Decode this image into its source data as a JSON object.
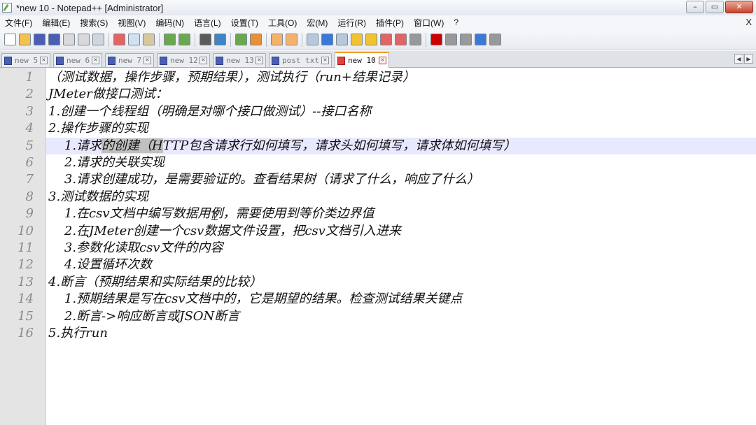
{
  "window": {
    "title": "*new 10 - Notepad++ [Administrator]",
    "minimize": "–",
    "maximize": "▭",
    "close": "✕"
  },
  "menu": [
    {
      "label": "文件(F)"
    },
    {
      "label": "编辑(E)"
    },
    {
      "label": "搜索(S)"
    },
    {
      "label": "视图(V)"
    },
    {
      "label": "编码(N)"
    },
    {
      "label": "语言(L)"
    },
    {
      "label": "设置(T)"
    },
    {
      "label": "工具(O)"
    },
    {
      "label": "宏(M)"
    },
    {
      "label": "运行(R)"
    },
    {
      "label": "插件(P)"
    },
    {
      "label": "窗口(W)"
    },
    {
      "label": "?"
    }
  ],
  "menu_close": "X",
  "toolbar_icons": [
    {
      "name": "new-file-icon",
      "color": "#ffffff"
    },
    {
      "name": "open-file-icon",
      "color": "#f2c14e"
    },
    {
      "name": "save-icon",
      "color": "#4a5fb4"
    },
    {
      "name": "save-all-icon",
      "color": "#4a5fb4"
    },
    {
      "name": "close-icon",
      "color": "#d9d9d9"
    },
    {
      "name": "close-all-icon",
      "color": "#d9d9d9"
    },
    {
      "name": "print-icon",
      "color": "#cfd6de"
    },
    {
      "sep": true
    },
    {
      "name": "cut-icon",
      "color": "#e06666"
    },
    {
      "name": "copy-icon",
      "color": "#cfe2f3"
    },
    {
      "name": "paste-icon",
      "color": "#d9c89e"
    },
    {
      "sep": true
    },
    {
      "name": "undo-icon",
      "color": "#6aa84f"
    },
    {
      "name": "redo-icon",
      "color": "#6aa84f"
    },
    {
      "sep": true
    },
    {
      "name": "find-icon",
      "color": "#5b5b5b"
    },
    {
      "name": "replace-icon",
      "color": "#3d85c6"
    },
    {
      "sep": true
    },
    {
      "name": "zoom-in-icon",
      "color": "#6aa84f"
    },
    {
      "name": "zoom-out-icon",
      "color": "#e69138"
    },
    {
      "sep": true
    },
    {
      "name": "sync-vertical-icon",
      "color": "#f6b26b"
    },
    {
      "name": "sync-horizontal-icon",
      "color": "#f6b26b"
    },
    {
      "sep": true
    },
    {
      "name": "word-wrap-icon",
      "color": "#b7c7dc"
    },
    {
      "name": "show-all-chars-icon",
      "color": "#3c78d8"
    },
    {
      "name": "indent-guide-icon",
      "color": "#b7c7dc"
    },
    {
      "name": "doc-map-icon",
      "color": "#f1c232"
    },
    {
      "name": "function-list-icon",
      "color": "#f1c232"
    },
    {
      "name": "folder-workspace-icon",
      "color": "#e06666"
    },
    {
      "name": "monitoring-icon",
      "color": "#e06666"
    },
    {
      "name": "bubble-icon",
      "color": "#999999"
    },
    {
      "sep": true
    },
    {
      "name": "record-macro-icon",
      "color": "#cc0000"
    },
    {
      "name": "stop-macro-icon",
      "color": "#999999"
    },
    {
      "name": "play-macro-icon",
      "color": "#999999"
    },
    {
      "name": "run-macro-multiple-icon",
      "color": "#3c78d8"
    },
    {
      "name": "save-macro-icon",
      "color": "#999999"
    }
  ],
  "tabs": [
    {
      "label": "new 5",
      "active": false
    },
    {
      "label": "new 6",
      "active": false
    },
    {
      "label": "new 7",
      "active": false
    },
    {
      "label": "new 12",
      "active": false
    },
    {
      "label": "new 13",
      "active": false
    },
    {
      "label": "post txt",
      "active": false
    },
    {
      "label": "new 10",
      "active": true
    }
  ],
  "tab_nav": {
    "prev": "◀",
    "next": "▶"
  },
  "editor": {
    "current_line": 5,
    "lines": [
      {
        "num": "1",
        "text": "（测试数据，操作步骤，预期结果），测试执行（run+结果记录）"
      },
      {
        "num": "2",
        "text": "JMeter做接口测试："
      },
      {
        "num": "3",
        "text": "1.创建一个线程组（明确是对哪个接口做测试）--接口名称"
      },
      {
        "num": "4",
        "text": "2.操作步骤的实现"
      },
      {
        "num": "5",
        "text": "    1.请求的创建（HTTP包含请求行如何填写，请求头如何填写，请求体如何填写）"
      },
      {
        "num": "6",
        "text": "    2.请求的关联实现"
      },
      {
        "num": "7",
        "text": "    3.请求创建成功，是需要验证的。查看结果树（请求了什么，响应了什么）"
      },
      {
        "num": "8",
        "text": "3.测试数据的实现"
      },
      {
        "num": "9",
        "text": "    1.在csv文档中编写数据用例，需要使用到等价类边界值"
      },
      {
        "num": "10",
        "text": "    2.在JMeter创建一个csv数据文件设置，把csv文档引入进来"
      },
      {
        "num": "11",
        "text": "    3.参数化读取csv文件的内容"
      },
      {
        "num": "12",
        "text": "    4.设置循环次数"
      },
      {
        "num": "13",
        "text": "4.断言（预期结果和实际结果的比较）"
      },
      {
        "num": "14",
        "text": "    1.预期结果是写在csv文档中的，它是期望的结果。检查测试结果关键点"
      },
      {
        "num": "15",
        "text": "    2.断言->响应断言或JSON断言"
      },
      {
        "num": "16",
        "text": "5.执行run"
      }
    ],
    "selection": {
      "line": 5,
      "text_before": "    1.请求",
      "text_selected": "的创建（H",
      "text_after": "TTP包含请求行如何填写，请求头如何填写，请求体如何填写）"
    }
  },
  "colors": {
    "current_line_bg": "#e8e8ff",
    "selection_bg": "#c0c0c0",
    "gutter_bg": "#e4e4e4",
    "active_tab_accent": "#f0a030"
  }
}
